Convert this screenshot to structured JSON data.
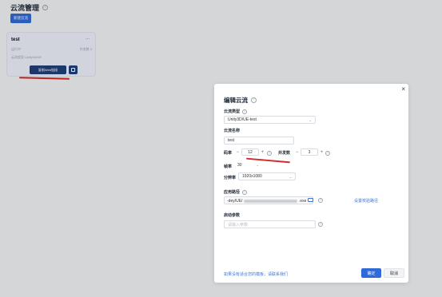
{
  "page": {
    "title": "云流管理",
    "new_button": "新建云流"
  },
  "card": {
    "name": "test",
    "more": "...",
    "status": "运行中",
    "concurrency": "并发数 3",
    "type": "云流类型 Unity3D/UE",
    "link_button": "复制Web链接"
  },
  "modal": {
    "title": "编辑云流",
    "close": "×",
    "type_label": "云流类型",
    "type_value": "Unity3D/UE-test",
    "name_label": "云流名称",
    "name_value": "test",
    "bitrate_label": "码率",
    "bitrate_value": "12",
    "concurrency_label": "并发数",
    "concurrency_value": "3",
    "fps_label": "帧率",
    "fps_value": "30",
    "resolution_label": "分辨率",
    "resolution_value": "1920x1080",
    "path_label": "应用路径",
    "path_prefix": "-dey/UE/",
    "path_suffix": ".exe",
    "path_link": "设置校验路径",
    "args_label": "启动参数",
    "args_placeholder": "请输入参数",
    "footer_link": "如果没有适合您的模板，请联系我们",
    "ok": "确定",
    "cancel": "取消"
  },
  "colors": {
    "primary": "#2f6ad9",
    "annotation": "#d62828"
  }
}
